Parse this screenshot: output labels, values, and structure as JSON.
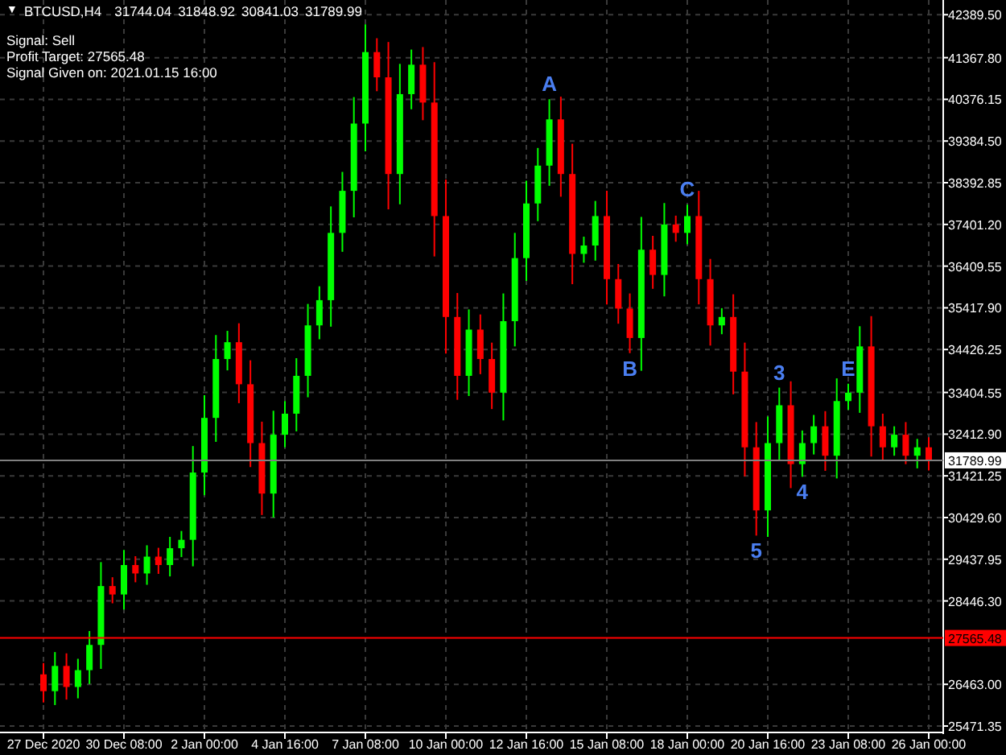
{
  "header": {
    "glyph": "▼",
    "symbol": "BTCUSD,H4",
    "quotes": [
      "31744.04",
      "31848.92",
      "30841.03",
      "31789.99"
    ]
  },
  "signal_lines": [
    "Signal: Sell",
    "Profit Target: 27565.48",
    "Signal Given on: 2021.01.15 16:00"
  ],
  "chart": {
    "chart_data": {
      "type": "candlestick",
      "grid": true,
      "ylim": [
        25318,
        42739
      ],
      "yticks": [
        {
          "value": 42389.5,
          "label": "42389.50"
        },
        {
          "value": 41367.8,
          "label": "41367.80"
        },
        {
          "value": 40376.15,
          "label": "40376.15"
        },
        {
          "value": 39384.5,
          "label": "39384.50"
        },
        {
          "value": 38392.85,
          "label": "38392.85"
        },
        {
          "value": 37401.2,
          "label": "37401.20"
        },
        {
          "value": 36409.55,
          "label": "36409.55"
        },
        {
          "value": 35417.9,
          "label": "35417.90"
        },
        {
          "value": 34426.25,
          "label": "34426.25"
        },
        {
          "value": 33404.55,
          "label": "33404.55"
        },
        {
          "value": 32412.9,
          "label": "32412.90"
        },
        {
          "value": 31421.25,
          "label": "31421.25"
        },
        {
          "value": 30429.6,
          "label": "30429.60"
        },
        {
          "value": 29437.95,
          "label": "29437.95"
        },
        {
          "value": 28446.3,
          "label": "28446.30"
        },
        {
          "value": 26463,
          "label": "26463.00"
        },
        {
          "value": 25471.35,
          "label": "25471.35"
        }
      ],
      "categories": [
        "27 Dec 2020",
        null,
        null,
        null,
        null,
        null,
        null,
        "30 Dec 08:00",
        null,
        null,
        null,
        null,
        null,
        null,
        "2 Jan 00:00",
        null,
        null,
        null,
        null,
        null,
        null,
        "4 Jan 16:00",
        null,
        null,
        null,
        null,
        null,
        null,
        "7 Jan 08:00",
        null,
        null,
        null,
        null,
        null,
        null,
        "10 Jan 00:00",
        null,
        null,
        null,
        null,
        null,
        null,
        "12 Jan 16:00",
        null,
        null,
        null,
        null,
        null,
        null,
        "15 Jan 08:00",
        null,
        null,
        null,
        null,
        null,
        null,
        "18 Jan 00:00",
        null,
        null,
        null,
        null,
        null,
        null,
        "20 Jan 16:00",
        null,
        null,
        null,
        null,
        null,
        null,
        "23 Jan 08:00",
        null,
        null,
        null,
        null,
        null,
        null,
        "26 Jan 00:00"
      ],
      "ohlc": [
        [
          26700,
          26970,
          26030,
          26300
        ],
        [
          26300,
          27230,
          25970,
          26900
        ],
        [
          26900,
          27200,
          26100,
          26400
        ],
        [
          26400,
          27070,
          26130,
          26800
        ],
        [
          26800,
          27730,
          26470,
          27400
        ],
        [
          27400,
          29370,
          26830,
          28800
        ],
        [
          28800,
          29010,
          28390,
          28600
        ],
        [
          28600,
          29660,
          28240,
          29300
        ],
        [
          29300,
          29510,
          28890,
          29100
        ],
        [
          29100,
          29770,
          28830,
          29500
        ],
        [
          29500,
          29710,
          29090,
          29300
        ],
        [
          29300,
          29970,
          29030,
          29700
        ],
        [
          29700,
          30110,
          29490,
          29900
        ],
        [
          29900,
          32130,
          29270,
          31500
        ],
        [
          31500,
          33340,
          30960,
          32800
        ],
        [
          32800,
          34770,
          32230,
          34200
        ],
        [
          34200,
          34870,
          33930,
          34600
        ],
        [
          34600,
          35050,
          33150,
          33600
        ],
        [
          33600,
          34170,
          31630,
          32200
        ],
        [
          32200,
          32710,
          30490,
          31000
        ],
        [
          31000,
          32970,
          30430,
          32400
        ],
        [
          32400,
          33200,
          32100,
          32900
        ],
        [
          32900,
          34220,
          32480,
          33800
        ],
        [
          33800,
          35510,
          33290,
          35000
        ],
        [
          35000,
          35930,
          34670,
          35600
        ],
        [
          35600,
          37830,
          34970,
          37200
        ],
        [
          37200,
          38650,
          36750,
          38200
        ],
        [
          38200,
          40430,
          37570,
          39800
        ],
        [
          39800,
          42160,
          39140,
          41500
        ],
        [
          41500,
          41830,
          40570,
          40900
        ],
        [
          40900,
          41740,
          37760,
          38600
        ],
        [
          38600,
          41220,
          37880,
          40500
        ],
        [
          40500,
          41560,
          40140,
          41200
        ],
        [
          41200,
          41620,
          39880,
          40300
        ],
        [
          40300,
          41260,
          36640,
          37600
        ],
        [
          37600,
          38470,
          34330,
          35200
        ],
        [
          35200,
          35770,
          33230,
          33800
        ],
        [
          33800,
          35380,
          33320,
          34900
        ],
        [
          34900,
          35260,
          33840,
          34200
        ],
        [
          34200,
          34590,
          33010,
          33400
        ],
        [
          33400,
          35760,
          32740,
          35100
        ],
        [
          35100,
          37200,
          34500,
          36600
        ],
        [
          36600,
          38440,
          36060,
          37900
        ],
        [
          37900,
          39220,
          37480,
          38800
        ],
        [
          38800,
          40380,
          38320,
          39900
        ],
        [
          39900,
          40440,
          38060,
          38600
        ],
        [
          38600,
          39320,
          35980,
          36700
        ],
        [
          36700,
          37110,
          36490,
          36900
        ],
        [
          36900,
          37960,
          36540,
          37600
        ],
        [
          37600,
          38200,
          35500,
          36100
        ],
        [
          36100,
          36460,
          35040,
          35400
        ],
        [
          35400,
          35760,
          34340,
          34700
        ],
        [
          34700,
          37580,
          33920,
          36800
        ],
        [
          36800,
          37130,
          35870,
          36200
        ],
        [
          36200,
          37910,
          35690,
          37400
        ],
        [
          37400,
          37610,
          36990,
          37200
        ],
        [
          37200,
          37870,
          36930,
          37600
        ],
        [
          37600,
          38200,
          35500,
          36100
        ],
        [
          36100,
          36580,
          34520,
          35000
        ],
        [
          35000,
          35410,
          34790,
          35200
        ],
        [
          35200,
          35740,
          33360,
          33900
        ],
        [
          33900,
          34590,
          31410,
          32100
        ],
        [
          32100,
          32700,
          30000,
          30600
        ],
        [
          30600,
          32830,
          29970,
          32200
        ],
        [
          32200,
          33520,
          31780,
          33100
        ],
        [
          33100,
          33670,
          31130,
          31700
        ],
        [
          31700,
          32500,
          31400,
          32200
        ],
        [
          32200,
          32870,
          31930,
          32600
        ],
        [
          32600,
          32960,
          31540,
          31900
        ],
        [
          31900,
          33740,
          31360,
          33200
        ],
        [
          33200,
          33610,
          32990,
          33400
        ],
        [
          33400,
          34980,
          32920,
          34500
        ],
        [
          34500,
          35220,
          31880,
          32600
        ],
        [
          32600,
          32900,
          31800,
          32100
        ],
        [
          32100,
          32600,
          31900,
          32400
        ],
        [
          32400,
          32700,
          31700,
          31900
        ],
        [
          31900,
          32300,
          31600,
          32100
        ],
        [
          32100,
          32340,
          31550,
          31789.99
        ]
      ],
      "ref_lines": [
        {
          "axis": "y",
          "value": 31789.99,
          "label": "31789.99",
          "color": "#808080"
        },
        {
          "axis": "y",
          "value": 27565.48,
          "label": "27565.48",
          "color": "#ff0000"
        }
      ],
      "annotations": [
        "A",
        "B",
        "C",
        "5",
        "3",
        "4",
        "E"
      ]
    }
  }
}
